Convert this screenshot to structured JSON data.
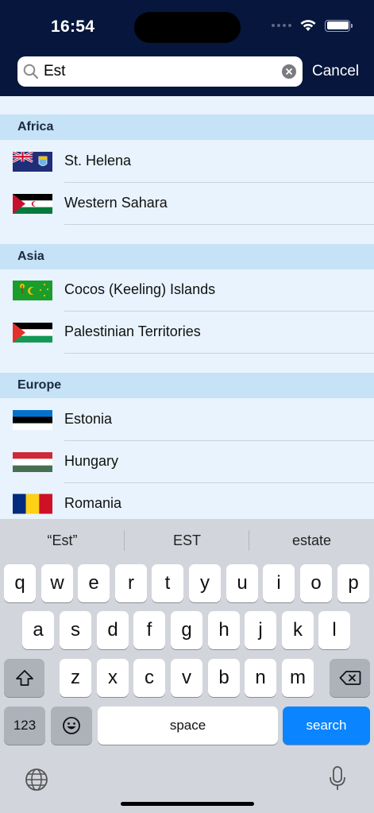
{
  "status_bar": {
    "time": "16:54"
  },
  "search": {
    "value": "Est",
    "cancel_label": "Cancel"
  },
  "sections": [
    {
      "title": "Africa",
      "items": [
        {
          "label": "St. Helena",
          "flag": "st-helena"
        },
        {
          "label": "Western Sahara",
          "flag": "western-sahara"
        }
      ]
    },
    {
      "title": "Asia",
      "items": [
        {
          "label": "Cocos (Keeling) Islands",
          "flag": "cocos-islands"
        },
        {
          "label": "Palestinian Territories",
          "flag": "palestine"
        }
      ]
    },
    {
      "title": "Europe",
      "items": [
        {
          "label": "Estonia",
          "flag": "estonia"
        },
        {
          "label": "Hungary",
          "flag": "hungary"
        },
        {
          "label": "Romania",
          "flag": "romania"
        }
      ]
    }
  ],
  "keyboard": {
    "suggestions": [
      "“Est”",
      "EST",
      "estate"
    ],
    "row1": [
      "q",
      "w",
      "e",
      "r",
      "t",
      "y",
      "u",
      "i",
      "o",
      "p"
    ],
    "row2": [
      "a",
      "s",
      "d",
      "f",
      "g",
      "h",
      "j",
      "k",
      "l"
    ],
    "row3": [
      "z",
      "x",
      "c",
      "v",
      "b",
      "n",
      "m"
    ],
    "numbers_label": "123",
    "space_label": "space",
    "search_label": "search"
  },
  "colors": {
    "nav": "#06163c",
    "list_bg": "#e8f3fd",
    "section_bg": "#c5e2f7",
    "search_key": "#0a84ff"
  }
}
